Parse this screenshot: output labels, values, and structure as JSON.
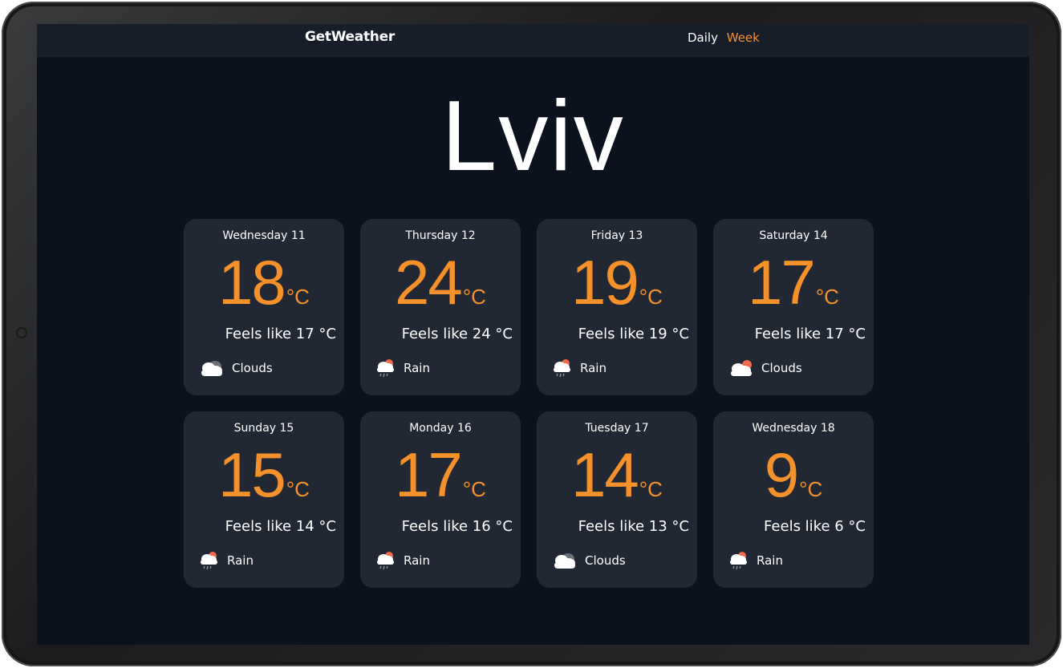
{
  "app": {
    "brand": "GetWeather"
  },
  "nav": {
    "items": [
      {
        "label": "Daily"
      },
      {
        "label": "Week"
      }
    ],
    "active": "Week"
  },
  "city": "Lviv",
  "forecast": [
    {
      "day": "Wednesday 11",
      "temp": "18",
      "unit": "°C",
      "feels": "Feels like 17 °C",
      "condition": "Clouds",
      "icon": "clouds-icon"
    },
    {
      "day": "Thursday 12",
      "temp": "24",
      "unit": "°C",
      "feels": "Feels like 24 °C",
      "condition": "Rain",
      "icon": "rain-icon"
    },
    {
      "day": "Friday 13",
      "temp": "19",
      "unit": "°C",
      "feels": "Feels like 19 °C",
      "condition": "Rain",
      "icon": "rain-icon"
    },
    {
      "day": "Saturday 14",
      "temp": "17",
      "unit": "°C",
      "feels": "Feels like 17 °C",
      "condition": "Clouds",
      "icon": "sun-clouds-icon"
    },
    {
      "day": "Sunday 15",
      "temp": "15",
      "unit": "°C",
      "feels": "Feels like 14 °C",
      "condition": "Rain",
      "icon": "rain-icon"
    },
    {
      "day": "Monday 16",
      "temp": "17",
      "unit": "°C",
      "feels": "Feels like 16 °C",
      "condition": "Rain",
      "icon": "rain-icon"
    },
    {
      "day": "Tuesday 17",
      "temp": "14",
      "unit": "°C",
      "feels": "Feels like 13 °C",
      "condition": "Clouds",
      "icon": "clouds-icon"
    },
    {
      "day": "Wednesday 18",
      "temp": "9",
      "unit": "°C",
      "feels": "Feels like 6 °C",
      "condition": "Rain",
      "icon": "rain-icon"
    }
  ],
  "colors": {
    "accent": "#f5912b",
    "background": "#0b111d",
    "card": "#222833",
    "navbar": "#171e29"
  }
}
